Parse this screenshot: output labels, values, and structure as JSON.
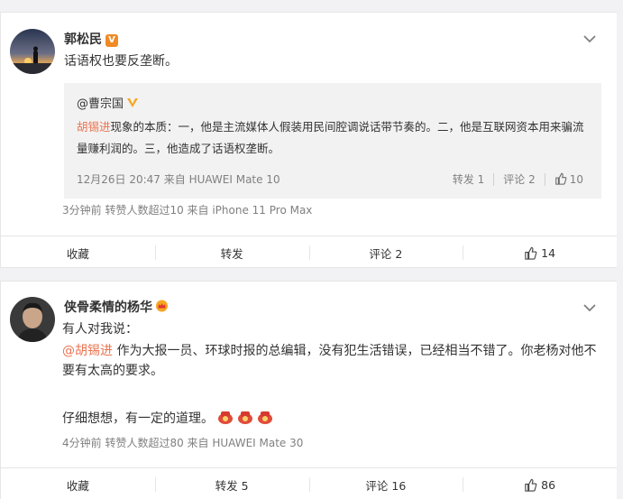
{
  "posts": [
    {
      "username": "郭松民",
      "badge": "V",
      "text": "话语权也要反垄断。",
      "repost": {
        "user": "@曹宗国",
        "body_mention": "胡锡进",
        "body": "现象的本质：一，他是主流媒体人假装用民间腔调说话带节奏的。二，他是互联网资本用来骗流量赚利润的。三，他造成了话语权垄断。",
        "meta": "12月26日 20:47 来自 HUAWEI Mate 10",
        "repost_label": "转发 1",
        "comment_label": "评论 2",
        "like_count": "10"
      },
      "meta": "3分钟前 转赞人数超过10  来自 iPhone 11 Pro Max",
      "actions": {
        "favorite": "收藏",
        "repost": "转发",
        "comment": "评论 2",
        "like": "14"
      }
    },
    {
      "username": "侠骨柔情的杨华",
      "line1": "有人对我说：",
      "mention": "@胡锡进",
      "line2": " 作为大报一员、环球时报的总编辑，没有犯生活错误，已经相当不错了。你老杨对他不要有太高的要求。",
      "line3": "仔细想想，有一定的道理。",
      "meta": "4分钟前 转赞人数超过80  来自 HUAWEI Mate 30",
      "actions": {
        "favorite": "收藏",
        "repost": "转发 5",
        "comment": "评论 16",
        "like": "86"
      }
    }
  ],
  "colors": {
    "mention": "#eb7350",
    "meta": "#808080",
    "badge": "#f08a24"
  }
}
